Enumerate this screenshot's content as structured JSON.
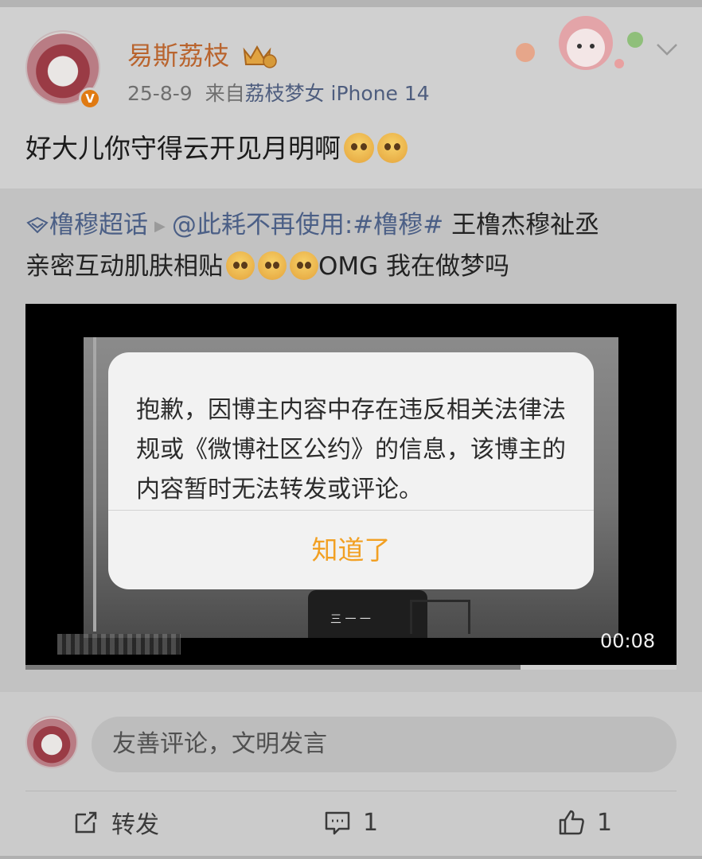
{
  "post": {
    "username": "易斯荔枝",
    "date": "25-8-9",
    "source_prefix": "来自",
    "source": "荔枝梦女 iPhone 14",
    "text": "好大儿你守得云开见月明啊"
  },
  "repost": {
    "topic": "橹穆超话",
    "author": "@此耗不再使用",
    "hashtag": ":#橹穆#",
    "text_line1": " 王橹杰穆祉丞",
    "text_line2": "亲密互动肌肤相贴",
    "text_tail": "OMG 我在做梦吗"
  },
  "video": {
    "timestamp": "00:08",
    "progress": 0.24
  },
  "dialog": {
    "message": "抱歉，因博主内容中存在违反相关法律法规或《微博社区公约》的信息，该博主的内容暂时无法转发或评论。",
    "button": "知道了"
  },
  "comment": {
    "placeholder": "友善评论，文明发言"
  },
  "actions": {
    "repost_label": "转发",
    "comment_count": "1",
    "like_count": "1"
  },
  "colors": {
    "username": "#b9642e",
    "link": "#4b5f86",
    "dialog_button": "#f2a023",
    "verified_badge": "#e07a12"
  },
  "icons": [
    "crown-badge-icon",
    "chevron-down-icon",
    "supertopic-icon",
    "play-triangle-icon",
    "repost-icon",
    "comment-icon",
    "like-icon"
  ]
}
